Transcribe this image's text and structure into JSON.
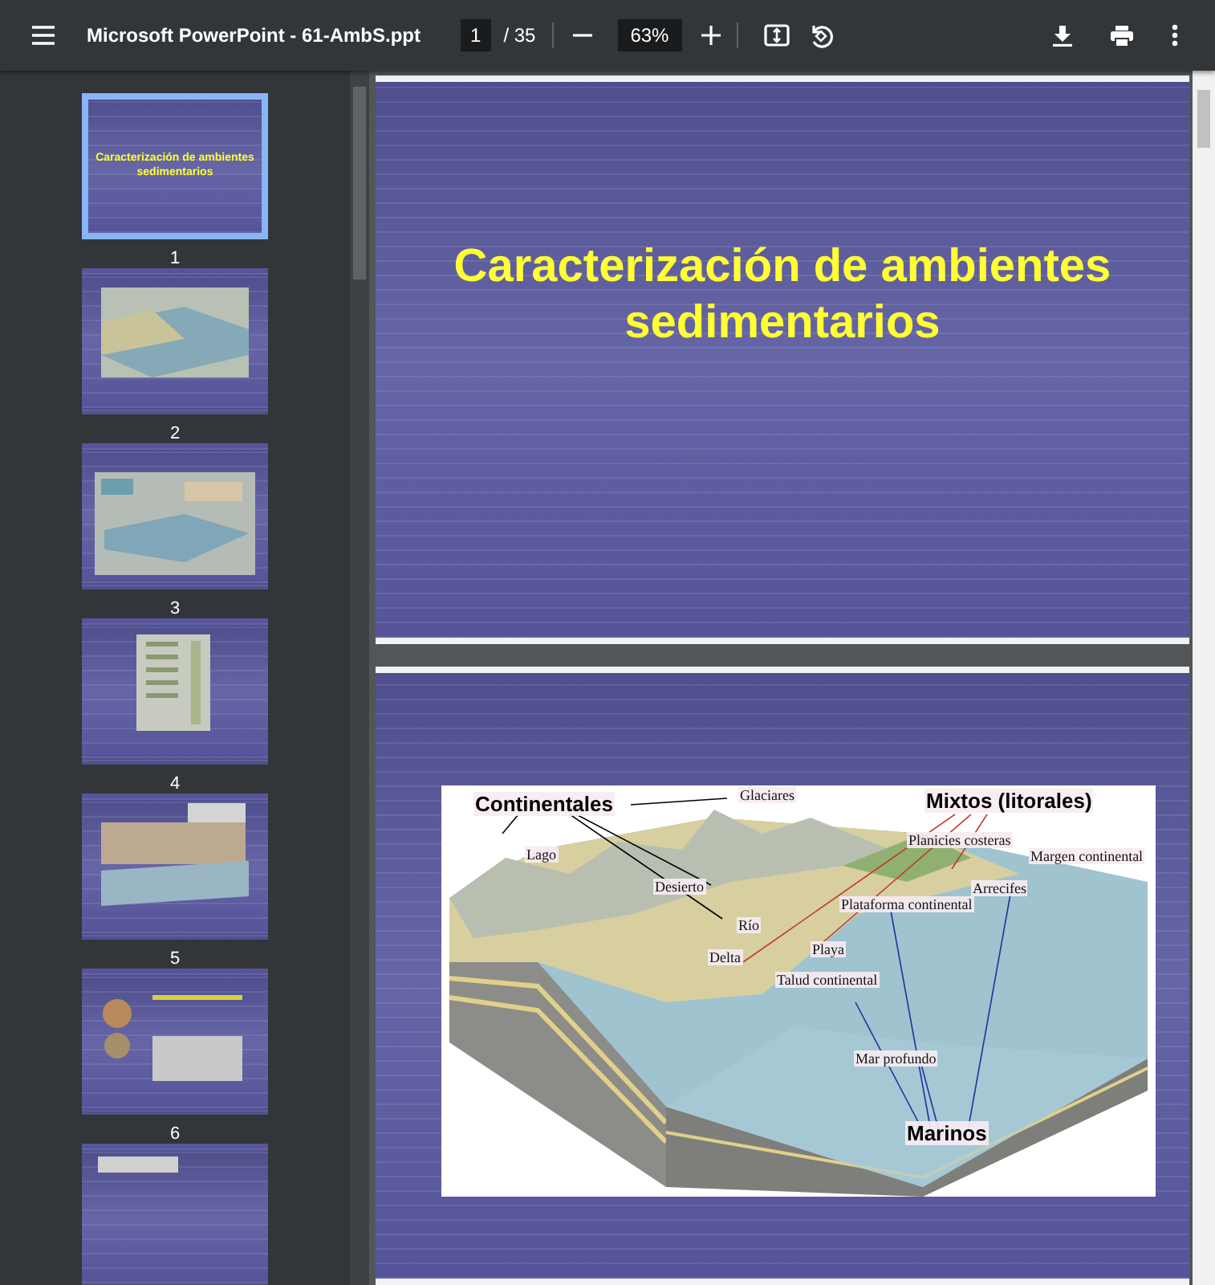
{
  "toolbar": {
    "title": "Microsoft PowerPoint - 61-AmbS.ppt",
    "page": "1",
    "page_total": "/ 35",
    "zoom": "63%"
  },
  "thumbnails": [
    {
      "label": "1",
      "selected": true,
      "title": "Caracterización de ambientes sedimentarios"
    },
    {
      "label": "2",
      "selected": false
    },
    {
      "label": "3",
      "selected": false
    },
    {
      "label": "4",
      "selected": false
    },
    {
      "label": "5",
      "selected": false
    },
    {
      "label": "6",
      "selected": false
    },
    {
      "selected": false
    }
  ],
  "pages": [
    {
      "kind": "title",
      "title": "Caracterización de ambientes sedimentarios"
    },
    {
      "kind": "diagram",
      "labels": [
        {
          "text": "Continentales",
          "kind": "heading"
        },
        {
          "text": "Glaciares",
          "kind": "label"
        },
        {
          "text": "Mixtos (litorales)",
          "kind": "heading"
        },
        {
          "text": "Lago",
          "kind": "label"
        },
        {
          "text": "Planicies costeras",
          "kind": "label"
        },
        {
          "text": "Margen continental",
          "kind": "label"
        },
        {
          "text": "Desierto",
          "kind": "label"
        },
        {
          "text": "Arrecifes",
          "kind": "label"
        },
        {
          "text": "Plataforma continental",
          "kind": "label"
        },
        {
          "text": "Río",
          "kind": "label"
        },
        {
          "text": "Playa",
          "kind": "label"
        },
        {
          "text": "Delta",
          "kind": "label"
        },
        {
          "text": "Talud continental",
          "kind": "label"
        },
        {
          "text": "Mar profundo",
          "kind": "label"
        },
        {
          "text": "Marinos",
          "kind": "heading"
        }
      ]
    }
  ]
}
